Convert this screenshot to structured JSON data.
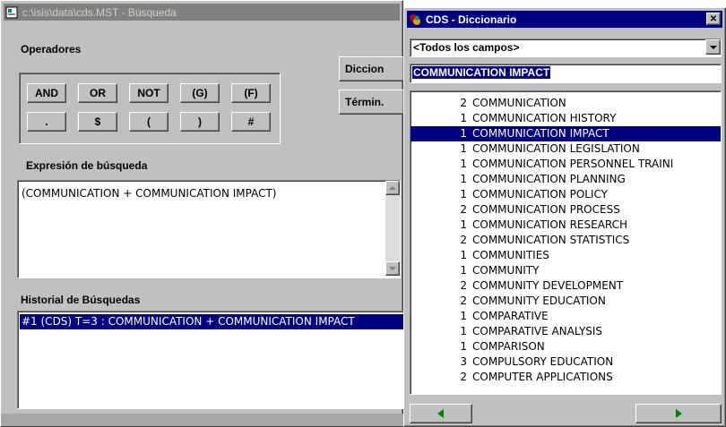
{
  "search_window": {
    "title": "c:\\isis\\data\\cds.MST - Búsqueda",
    "operators_label": "Operadores",
    "operators": [
      "AND",
      "OR",
      "NOT",
      "(G)",
      "(F)",
      ".",
      "$",
      "(",
      ")",
      "#"
    ],
    "dictionary_button": "Diccion",
    "terms_button": "Términ.",
    "expression_label": "Expresión de búsqueda",
    "expression_value": "(COMMUNICATION + COMMUNICATION IMPACT)",
    "history_label": "Historial de Búsquedas",
    "history_items": [
      "#1 (CDS) T=3 : COMMUNICATION + COMMUNICATION IMPACT"
    ]
  },
  "dictionary_window": {
    "title": "CDS - Diccionario",
    "close_glyph": "✕",
    "field_select_value": "<Todos los campos>",
    "term_input_value": "COMMUNICATION IMPACT",
    "selected_index": 2,
    "terms": [
      {
        "count": "2",
        "term": "COMMUNICATION"
      },
      {
        "count": "1",
        "term": "COMMUNICATION HISTORY"
      },
      {
        "count": "1",
        "term": "COMMUNICATION IMPACT"
      },
      {
        "count": "1",
        "term": "COMMUNICATION LEGISLATION"
      },
      {
        "count": "1",
        "term": "COMMUNICATION PERSONNEL TRAINI"
      },
      {
        "count": "1",
        "term": "COMMUNICATION PLANNING"
      },
      {
        "count": "1",
        "term": "COMMUNICATION POLICY"
      },
      {
        "count": "2",
        "term": "COMMUNICATION PROCESS"
      },
      {
        "count": "1",
        "term": "COMMUNICATION RESEARCH"
      },
      {
        "count": "2",
        "term": "COMMUNICATION STATISTICS"
      },
      {
        "count": "1",
        "term": "COMMUNITIES"
      },
      {
        "count": "1",
        "term": "COMMUNITY"
      },
      {
        "count": "2",
        "term": "COMMUNITY DEVELOPMENT"
      },
      {
        "count": "2",
        "term": "COMMUNITY EDUCATION"
      },
      {
        "count": "1",
        "term": "COMPARATIVE"
      },
      {
        "count": "1",
        "term": "COMPARATIVE ANALYSIS"
      },
      {
        "count": "1",
        "term": "COMPARISON"
      },
      {
        "count": "3",
        "term": "COMPULSORY EDUCATION"
      },
      {
        "count": "2",
        "term": "COMPUTER APPLICATIONS"
      }
    ]
  },
  "colors": {
    "title_active": "#000080",
    "title_inactive": "#808080",
    "face": "#c0c0c0",
    "selection": "#000080",
    "arrow_green": "#008000"
  }
}
